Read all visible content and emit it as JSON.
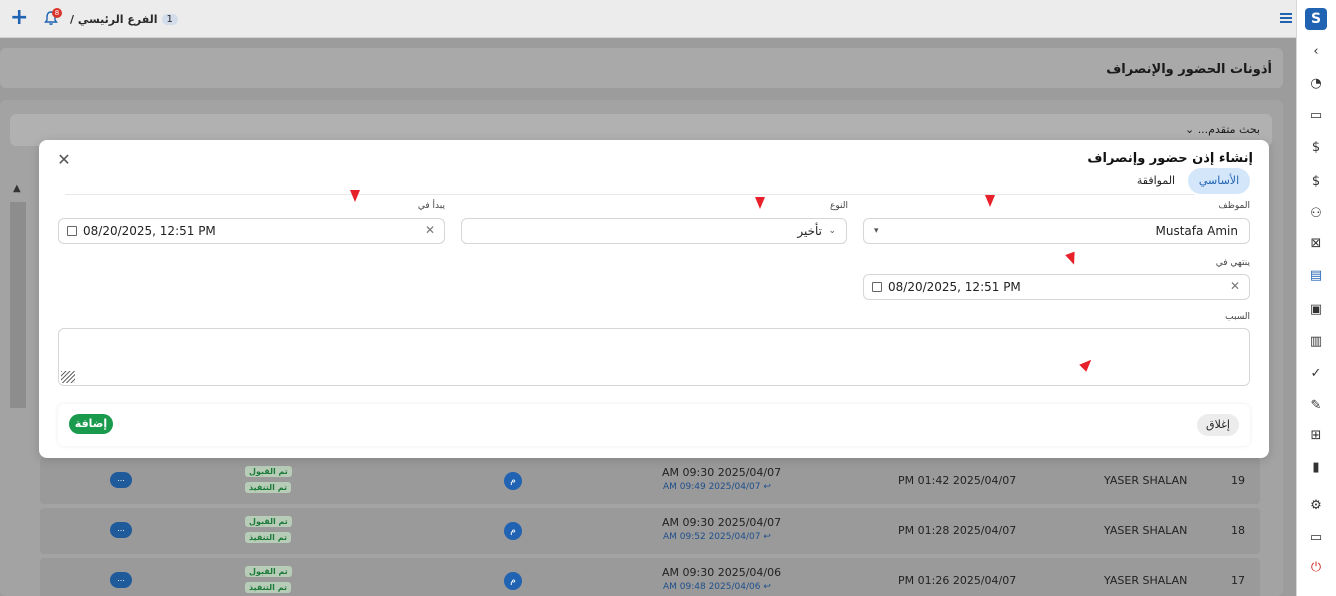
{
  "topbar": {
    "branch_num": "1",
    "branch_name": "الفرع الرئيسي /",
    "notif_count": "8"
  },
  "page": {
    "title": "أذونات الحضور والإنصراف",
    "advanced_search": "بحث متقدم..."
  },
  "table": {
    "rows": [
      {
        "idx": "19",
        "name": "YASER SHALAN",
        "time": "PM 01:42 2025/04/07",
        "t1": "AM 09:30 2025/04/07",
        "t2": "AM 09:49 2025/04/07 ↩",
        "mark": "م",
        "badge1": "تم القبول",
        "badge2": "تم التنفيذ",
        "more": "..."
      },
      {
        "idx": "18",
        "name": "YASER SHALAN",
        "time": "PM 01:28 2025/04/07",
        "t1": "AM 09:30 2025/04/07",
        "t2": "AM 09:52 2025/04/07 ↩",
        "mark": "م",
        "badge1": "تم القبول",
        "badge2": "تم التنفيذ",
        "more": "..."
      },
      {
        "idx": "17",
        "name": "YASER SHALAN",
        "time": "PM 01:26 2025/04/07",
        "t1": "AM 09:30 2025/04/06",
        "t2": "AM 09:48 2025/04/06 ↩",
        "mark": "م",
        "badge1": "تم القبول",
        "badge2": "تم التنفيذ",
        "more": "..."
      }
    ]
  },
  "modal": {
    "title": "إنشاء إذن حضور وإنصراف",
    "tab_basic": "الأساسي",
    "tab_approval": "الموافقة",
    "employee_label": "الموظف",
    "employee_value": "Mustafa Amin",
    "type_label": "النوع",
    "type_value": "تأخير",
    "starts_label": "يبدأ في",
    "starts_value": "08/20/2025, 12:51 PM",
    "ends_label": "ينتهي في",
    "ends_value": "08/20/2025, 12:51 PM",
    "reason_label": "السبب",
    "add_button": "إضافة",
    "close_button": "إغلاق"
  },
  "colors": {
    "primary": "#1f63b2",
    "success": "#1a9a4c",
    "annotation_arrow": "#e8202a",
    "tab_active_bg": "#d4e6fa"
  }
}
